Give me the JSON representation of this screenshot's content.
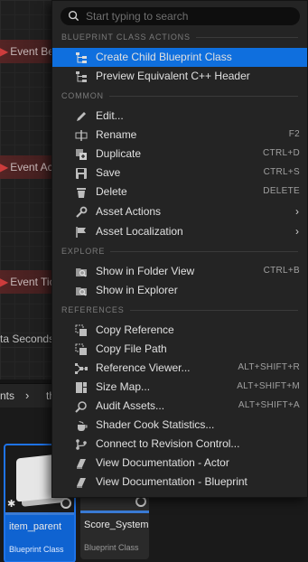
{
  "background": {
    "event_nodes": [
      "Event Be",
      "Event Ac",
      "Event Tick"
    ],
    "delta_text": "ta Seconds",
    "breadcrumbs": [
      "nts",
      "th"
    ],
    "breadcrumb_separator": "›",
    "tiles": [
      {
        "name": "item_parent",
        "kind": "Blueprint Class",
        "selected": true
      },
      {
        "name": "Score_System",
        "kind": "Blueprint Class",
        "selected": false
      }
    ]
  },
  "menu": {
    "search_placeholder": "Start typing to search",
    "sections": {
      "blueprint": "BLUEPRINT CLASS ACTIONS",
      "common": "COMMON",
      "explore": "EXPLORE",
      "references": "REFERENCES"
    },
    "items": {
      "create_child": {
        "label": "Create Child Blueprint Class",
        "icon": "class-hierarchy-icon"
      },
      "preview_cpp": {
        "label": "Preview Equivalent C++ Header",
        "icon": "class-hierarchy-icon"
      },
      "edit": {
        "label": "Edit...",
        "icon": "pencil-icon"
      },
      "rename": {
        "label": "Rename",
        "shortcut": "F2",
        "icon": "rename-icon"
      },
      "duplicate": {
        "label": "Duplicate",
        "shortcut": "CTRL+D",
        "icon": "duplicate-icon"
      },
      "save": {
        "label": "Save",
        "shortcut": "CTRL+S",
        "icon": "save-icon"
      },
      "delete": {
        "label": "Delete",
        "shortcut": "DELETE",
        "icon": "trash-icon"
      },
      "asset_actions": {
        "label": "Asset Actions",
        "icon": "wrench-icon"
      },
      "asset_localization": {
        "label": "Asset Localization",
        "icon": "flag-icon"
      },
      "show_folder": {
        "label": "Show in Folder View",
        "shortcut": "CTRL+B",
        "icon": "folder-search-icon"
      },
      "show_explorer": {
        "label": "Show in Explorer",
        "icon": "folder-search-icon"
      },
      "copy_reference": {
        "label": "Copy Reference",
        "icon": "copy-icon"
      },
      "copy_file_path": {
        "label": "Copy File Path",
        "icon": "copy-icon"
      },
      "reference_viewer": {
        "label": "Reference Viewer...",
        "shortcut": "ALT+SHIFT+R",
        "icon": "graph-icon"
      },
      "size_map": {
        "label": "Size Map...",
        "shortcut": "ALT+SHIFT+M",
        "icon": "size-map-icon"
      },
      "audit_assets": {
        "label": "Audit Assets...",
        "shortcut": "ALT+SHIFT+A",
        "icon": "audit-icon"
      },
      "shader_cook": {
        "label": "Shader Cook Statistics...",
        "icon": "teapot-icon"
      },
      "revision_control": {
        "label": "Connect to Revision Control...",
        "icon": "branch-icon"
      },
      "doc_actor": {
        "label": "View Documentation - Actor",
        "icon": "book-icon"
      },
      "doc_blueprint": {
        "label": "View Documentation - Blueprint",
        "icon": "book-icon"
      }
    },
    "submenu_arrow": "›"
  },
  "colors": {
    "highlight": "#0f6fde",
    "menu_bg": "#242424",
    "selected_tile": "#0f63d1"
  }
}
